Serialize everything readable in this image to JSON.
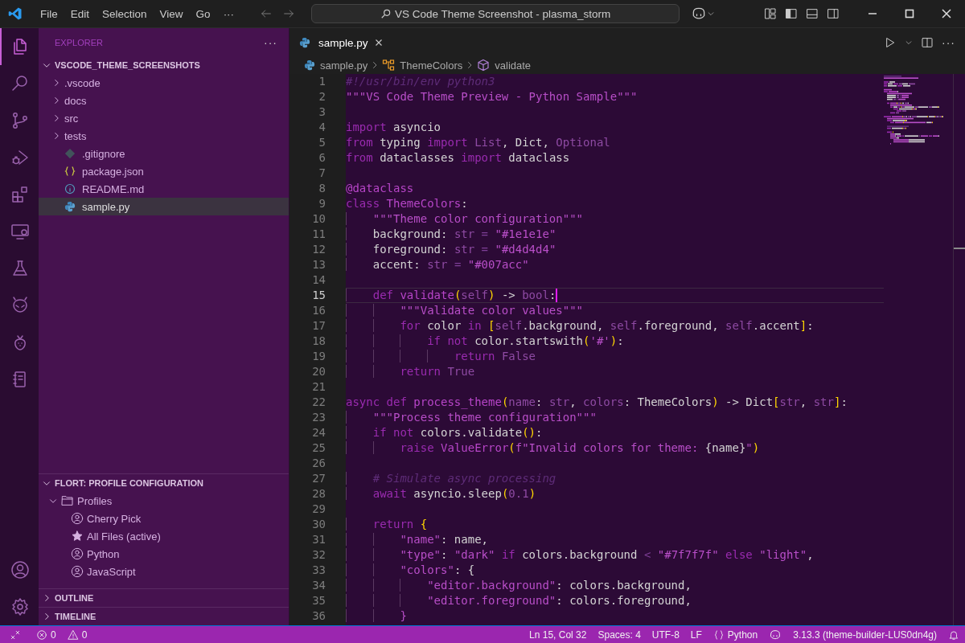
{
  "title_bar": {
    "menus": [
      "File",
      "Edit",
      "Selection",
      "View",
      "Go"
    ],
    "more": "···",
    "command_center": "VS Code Theme Screenshot - plasma_storm"
  },
  "activity_bar": [
    {
      "selected": true
    },
    {
      "selected": false
    },
    {
      "selected": false
    },
    {
      "selected": false
    },
    {
      "selected": false
    },
    {
      "selected": false
    },
    {
      "selected": false
    },
    {
      "selected": false
    },
    {
      "selected": false
    },
    {
      "selected": false
    }
  ],
  "explorer": {
    "title": "EXPLORER",
    "more": "···",
    "root": {
      "label": "VSCODE_THEME_SCREENSHOTS",
      "expanded": true,
      "children": [
        {
          "label": ".vscode",
          "kind": "folder",
          "selected": false
        },
        {
          "label": "docs",
          "kind": "folder",
          "selected": false
        },
        {
          "label": "src",
          "kind": "folder",
          "selected": false
        },
        {
          "label": "tests",
          "kind": "folder",
          "selected": false
        },
        {
          "label": ".gitignore",
          "kind": "git",
          "selected": false
        },
        {
          "label": "package.json",
          "kind": "json",
          "selected": false
        },
        {
          "label": "README.md",
          "kind": "info",
          "selected": false
        },
        {
          "label": "sample.py",
          "kind": "python",
          "selected": true
        }
      ]
    }
  },
  "profiles_section": {
    "title": "FLORT: PROFILE CONFIGURATION",
    "expanded": true,
    "folder": {
      "label": "Profiles",
      "expanded": true,
      "children": [
        {
          "label": "Cherry Pick",
          "kind": "profile"
        },
        {
          "label": "All Files (active)",
          "kind": "active"
        },
        {
          "label": "Python",
          "kind": "profile"
        },
        {
          "label": "JavaScript",
          "kind": "profile"
        }
      ]
    }
  },
  "collapsed_sections": [
    {
      "title": "OUTLINE",
      "expanded": false
    },
    {
      "title": "TIMELINE",
      "expanded": false
    }
  ],
  "editor": {
    "tabs": [
      {
        "label": "sample.py",
        "selected": true
      }
    ],
    "more": "···",
    "breadcrumbs": [
      {
        "label": "sample.py",
        "kind": "python"
      },
      {
        "label": "ThemeColors",
        "kind": "class"
      },
      {
        "label": "validate",
        "kind": "method"
      }
    ],
    "lines": [
      {
        "n": "1",
        "current": false,
        "tokens": [
          {
            "kind": "cm",
            "text": "#!/usr/bin/env python3"
          }
        ]
      },
      {
        "n": "2",
        "current": false,
        "tokens": [
          {
            "kind": "st",
            "text": "\"\"\"VS Code Theme Preview - Python Sample\"\"\""
          }
        ]
      },
      {
        "n": "3",
        "current": false
      },
      {
        "n": "4",
        "current": false,
        "tokens": [
          {
            "kind": "kw",
            "text": "import"
          },
          {
            "kind": "pl",
            "text": " asyncio"
          }
        ]
      },
      {
        "n": "5",
        "current": false,
        "tokens": [
          {
            "kind": "kw",
            "text": "from"
          },
          {
            "kind": "pl",
            "text": " typing "
          },
          {
            "kind": "kw",
            "text": "import"
          },
          {
            "kind": "ty",
            "text": " List"
          },
          {
            "kind": "pl",
            "text": ", Dict, "
          },
          {
            "kind": "ty",
            "text": "Optional"
          }
        ]
      },
      {
        "n": "6",
        "current": false,
        "tokens": [
          {
            "kind": "kw",
            "text": "from"
          },
          {
            "kind": "pl",
            "text": " dataclasses "
          },
          {
            "kind": "kw",
            "text": "import"
          },
          {
            "kind": "pl",
            "text": " dataclass"
          }
        ]
      },
      {
        "n": "7",
        "current": false
      },
      {
        "n": "8",
        "current": false,
        "tokens": [
          {
            "kind": "fn",
            "text": "@dataclass"
          }
        ]
      },
      {
        "n": "9",
        "current": false,
        "tokens": [
          {
            "kind": "kw",
            "text": "class"
          },
          {
            "kind": "fn",
            "text": " ThemeColors"
          },
          {
            "kind": "pl",
            "text": ":"
          }
        ]
      },
      {
        "n": "10",
        "current": false,
        "tokens": [
          {
            "kind": "st",
            "text": "    \"\"\"Theme color configuration\"\"\""
          }
        ]
      },
      {
        "n": "11",
        "current": false,
        "tokens": [
          {
            "kind": "pl",
            "text": "    background: "
          },
          {
            "kind": "ty",
            "text": "str"
          },
          {
            "kind": "op",
            "text": " = "
          },
          {
            "kind": "st",
            "text": "\"#1e1e1e\""
          }
        ]
      },
      {
        "n": "12",
        "current": false,
        "tokens": [
          {
            "kind": "pl",
            "text": "    foreground: "
          },
          {
            "kind": "ty",
            "text": "str"
          },
          {
            "kind": "op",
            "text": " = "
          },
          {
            "kind": "st",
            "text": "\"#d4d4d4\""
          }
        ]
      },
      {
        "n": "13",
        "current": false,
        "tokens": [
          {
            "kind": "pl",
            "text": "    accent: "
          },
          {
            "kind": "ty",
            "text": "str"
          },
          {
            "kind": "op",
            "text": " = "
          },
          {
            "kind": "st",
            "text": "\"#007acc\""
          }
        ]
      },
      {
        "n": "14",
        "current": false
      },
      {
        "n": "15",
        "current": true,
        "tokens": [
          {
            "kind": "kw",
            "text": "    def"
          },
          {
            "kind": "fn",
            "text": " validate"
          },
          {
            "kind": "br",
            "text": "("
          },
          {
            "kind": "ty",
            "text": "self"
          },
          {
            "kind": "br",
            "text": ")"
          },
          {
            "kind": "pl",
            "text": " -> "
          },
          {
            "kind": "ty",
            "text": "bool"
          },
          {
            "kind": "pl",
            "text": ":"
          }
        ]
      },
      {
        "n": "16",
        "current": false,
        "tokens": [
          {
            "kind": "st",
            "text": "        \"\"\"Validate color values\"\"\""
          }
        ]
      },
      {
        "n": "17",
        "current": false,
        "tokens": [
          {
            "kind": "kw",
            "text": "        for"
          },
          {
            "kind": "pl",
            "text": " color "
          },
          {
            "kind": "kw",
            "text": "in"
          },
          {
            "kind": "br",
            "text": " ["
          },
          {
            "kind": "ty",
            "text": "self"
          },
          {
            "kind": "pl",
            "text": ".background, "
          },
          {
            "kind": "ty",
            "text": "self"
          },
          {
            "kind": "pl",
            "text": ".foreground, "
          },
          {
            "kind": "ty",
            "text": "self"
          },
          {
            "kind": "pl",
            "text": ".accent"
          },
          {
            "kind": "br",
            "text": "]"
          },
          {
            "kind": "pl",
            "text": ":"
          }
        ]
      },
      {
        "n": "18",
        "current": false,
        "tokens": [
          {
            "kind": "kw",
            "text": "            if not"
          },
          {
            "kind": "pl",
            "text": " color.startswith"
          },
          {
            "kind": "br",
            "text": "("
          },
          {
            "kind": "st",
            "text": "'#'"
          },
          {
            "kind": "br",
            "text": ")"
          },
          {
            "kind": "pl",
            "text": ":"
          }
        ]
      },
      {
        "n": "19",
        "current": false,
        "tokens": [
          {
            "kind": "kw",
            "text": "                return"
          },
          {
            "kind": "ty",
            "text": " False"
          }
        ]
      },
      {
        "n": "20",
        "current": false,
        "tokens": [
          {
            "kind": "kw",
            "text": "        return"
          },
          {
            "kind": "ty",
            "text": " True"
          }
        ]
      },
      {
        "n": "21",
        "current": false
      },
      {
        "n": "22",
        "current": false,
        "tokens": [
          {
            "kind": "kw",
            "text": "async def"
          },
          {
            "kind": "fn",
            "text": " process_theme"
          },
          {
            "kind": "br",
            "text": "("
          },
          {
            "kind": "ty",
            "text": "name"
          },
          {
            "kind": "pl",
            "text": ": "
          },
          {
            "kind": "ty",
            "text": "str"
          },
          {
            "kind": "pl",
            "text": ", "
          },
          {
            "kind": "ty",
            "text": "colors"
          },
          {
            "kind": "pl",
            "text": ": ThemeColors"
          },
          {
            "kind": "br",
            "text": ")"
          },
          {
            "kind": "pl",
            "text": " -> Dict"
          },
          {
            "kind": "br",
            "text": "["
          },
          {
            "kind": "ty",
            "text": "str"
          },
          {
            "kind": "pl",
            "text": ", "
          },
          {
            "kind": "ty",
            "text": "str"
          },
          {
            "kind": "br",
            "text": "]"
          },
          {
            "kind": "pl",
            "text": ":"
          }
        ]
      },
      {
        "n": "23",
        "current": false,
        "tokens": [
          {
            "kind": "st",
            "text": "    \"\"\"Process theme configuration\"\"\""
          }
        ]
      },
      {
        "n": "24",
        "current": false,
        "tokens": [
          {
            "kind": "kw",
            "text": "    if not"
          },
          {
            "kind": "pl",
            "text": " colors.validate"
          },
          {
            "kind": "br",
            "text": "()"
          },
          {
            "kind": "pl",
            "text": ":"
          }
        ]
      },
      {
        "n": "25",
        "current": false,
        "tokens": [
          {
            "kind": "kw",
            "text": "        raise"
          },
          {
            "kind": "fn",
            "text": " ValueError"
          },
          {
            "kind": "br",
            "text": "("
          },
          {
            "kind": "st",
            "text": "f\"Invalid colors for theme: "
          },
          {
            "kind": "pl",
            "text": "{name}"
          },
          {
            "kind": "st",
            "text": "\""
          },
          {
            "kind": "br",
            "text": ")"
          }
        ]
      },
      {
        "n": "26",
        "current": false
      },
      {
        "n": "27",
        "current": false,
        "tokens": [
          {
            "kind": "cm",
            "text": "    # Simulate async processing"
          }
        ]
      },
      {
        "n": "28",
        "current": false,
        "tokens": [
          {
            "kind": "kw",
            "text": "    await"
          },
          {
            "kind": "pl",
            "text": " asyncio.sleep"
          },
          {
            "kind": "br",
            "text": "("
          },
          {
            "kind": "ty",
            "text": "0.1"
          },
          {
            "kind": "br",
            "text": ")"
          }
        ]
      },
      {
        "n": "29",
        "current": false
      },
      {
        "n": "30",
        "current": false,
        "tokens": [
          {
            "kind": "kw",
            "text": "    return"
          },
          {
            "kind": "br",
            "text": " {"
          }
        ]
      },
      {
        "n": "31",
        "current": false,
        "tokens": [
          {
            "kind": "st",
            "text": "        \"name\""
          },
          {
            "kind": "pl",
            "text": ": name,"
          }
        ]
      },
      {
        "n": "32",
        "current": false,
        "tokens": [
          {
            "kind": "st",
            "text": "        \"type\""
          },
          {
            "kind": "pl",
            "text": ": "
          },
          {
            "kind": "st",
            "text": "\"dark\""
          },
          {
            "kind": "kw",
            "text": " if"
          },
          {
            "kind": "pl",
            "text": " colors.background "
          },
          {
            "kind": "op",
            "text": "<"
          },
          {
            "kind": "st",
            "text": " \"#7f7f7f\""
          },
          {
            "kind": "kw",
            "text": " else"
          },
          {
            "kind": "st",
            "text": " \"light\""
          },
          {
            "kind": "pl",
            "text": ","
          }
        ]
      },
      {
        "n": "33",
        "current": false,
        "tokens": [
          {
            "kind": "st",
            "text": "        \"colors\""
          },
          {
            "kind": "pl",
            "text": ": {"
          }
        ]
      },
      {
        "n": "34",
        "current": false,
        "tokens": [
          {
            "kind": "st",
            "text": "            \"editor.background\""
          },
          {
            "kind": "pl",
            "text": ": colors.background,"
          }
        ]
      },
      {
        "n": "35",
        "current": false,
        "tokens": [
          {
            "kind": "st",
            "text": "            \"editor.foreground\""
          },
          {
            "kind": "pl",
            "text": ": colors.foreground,"
          }
        ]
      },
      {
        "n": "36",
        "current": false,
        "tokens": [
          {
            "kind": "st",
            "text": "        }"
          }
        ]
      }
    ]
  },
  "status_bar": {
    "left": [
      {
        "kind": "remote"
      },
      {
        "kind": "errors",
        "text": "0"
      },
      {
        "kind": "warnings",
        "text": "0"
      }
    ],
    "right": [
      {
        "kind": "text",
        "text": "Ln 15, Col 32"
      },
      {
        "kind": "text",
        "text": "Spaces: 4"
      },
      {
        "kind": "text",
        "text": "UTF-8"
      },
      {
        "kind": "text",
        "text": "LF"
      },
      {
        "kind": "language",
        "text": "Python"
      },
      {
        "kind": "copilot"
      },
      {
        "kind": "text",
        "text": "3.13.3 (theme-builder-LUS0dn4g)"
      },
      {
        "kind": "bell"
      }
    ]
  }
}
